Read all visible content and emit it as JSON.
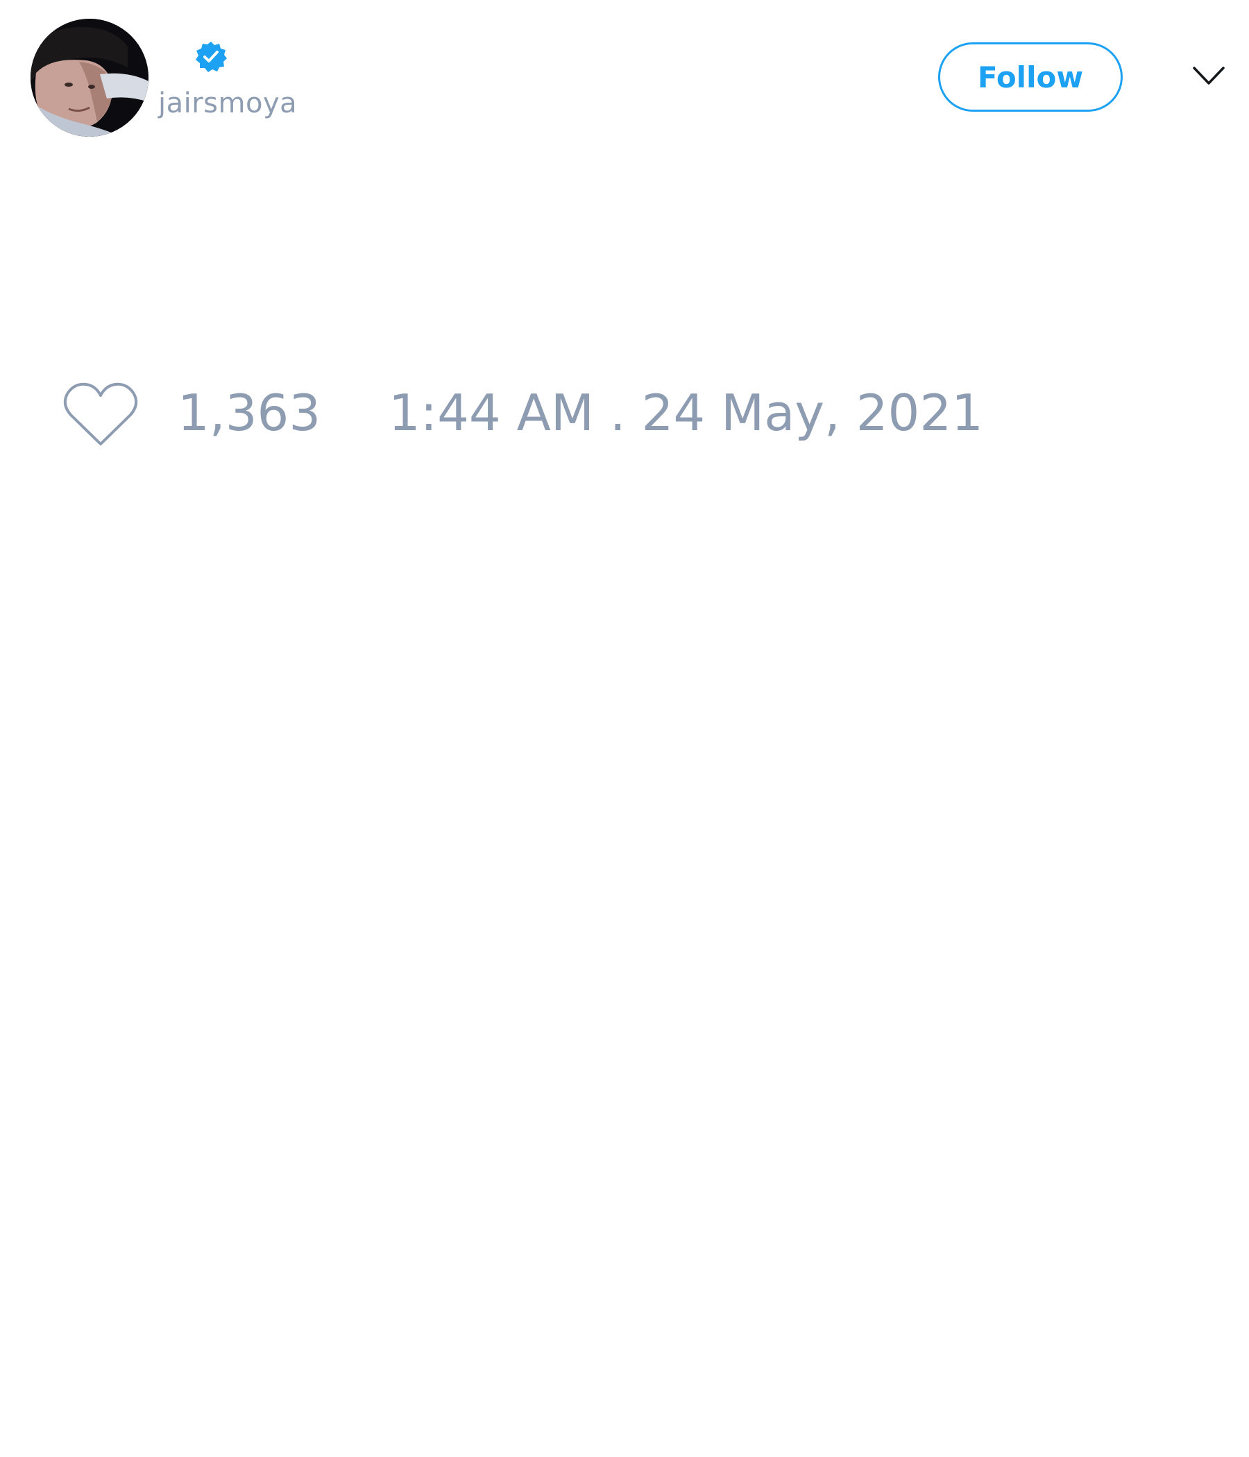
{
  "author": {
    "display_name": "",
    "handle": "jairsmoya",
    "verified": true,
    "avatar": "profile-photo"
  },
  "actions": {
    "follow_label": "Follow",
    "menu_icon": "chevron-down-icon"
  },
  "engagement": {
    "like_icon": "heart-outline-icon",
    "like_count": "1,363",
    "timestamp": "1:44 AM . 24 May, 2021"
  },
  "colors": {
    "accent": "#1da1f2",
    "muted_text": "#8e9cb2",
    "background": "#ffffff"
  }
}
